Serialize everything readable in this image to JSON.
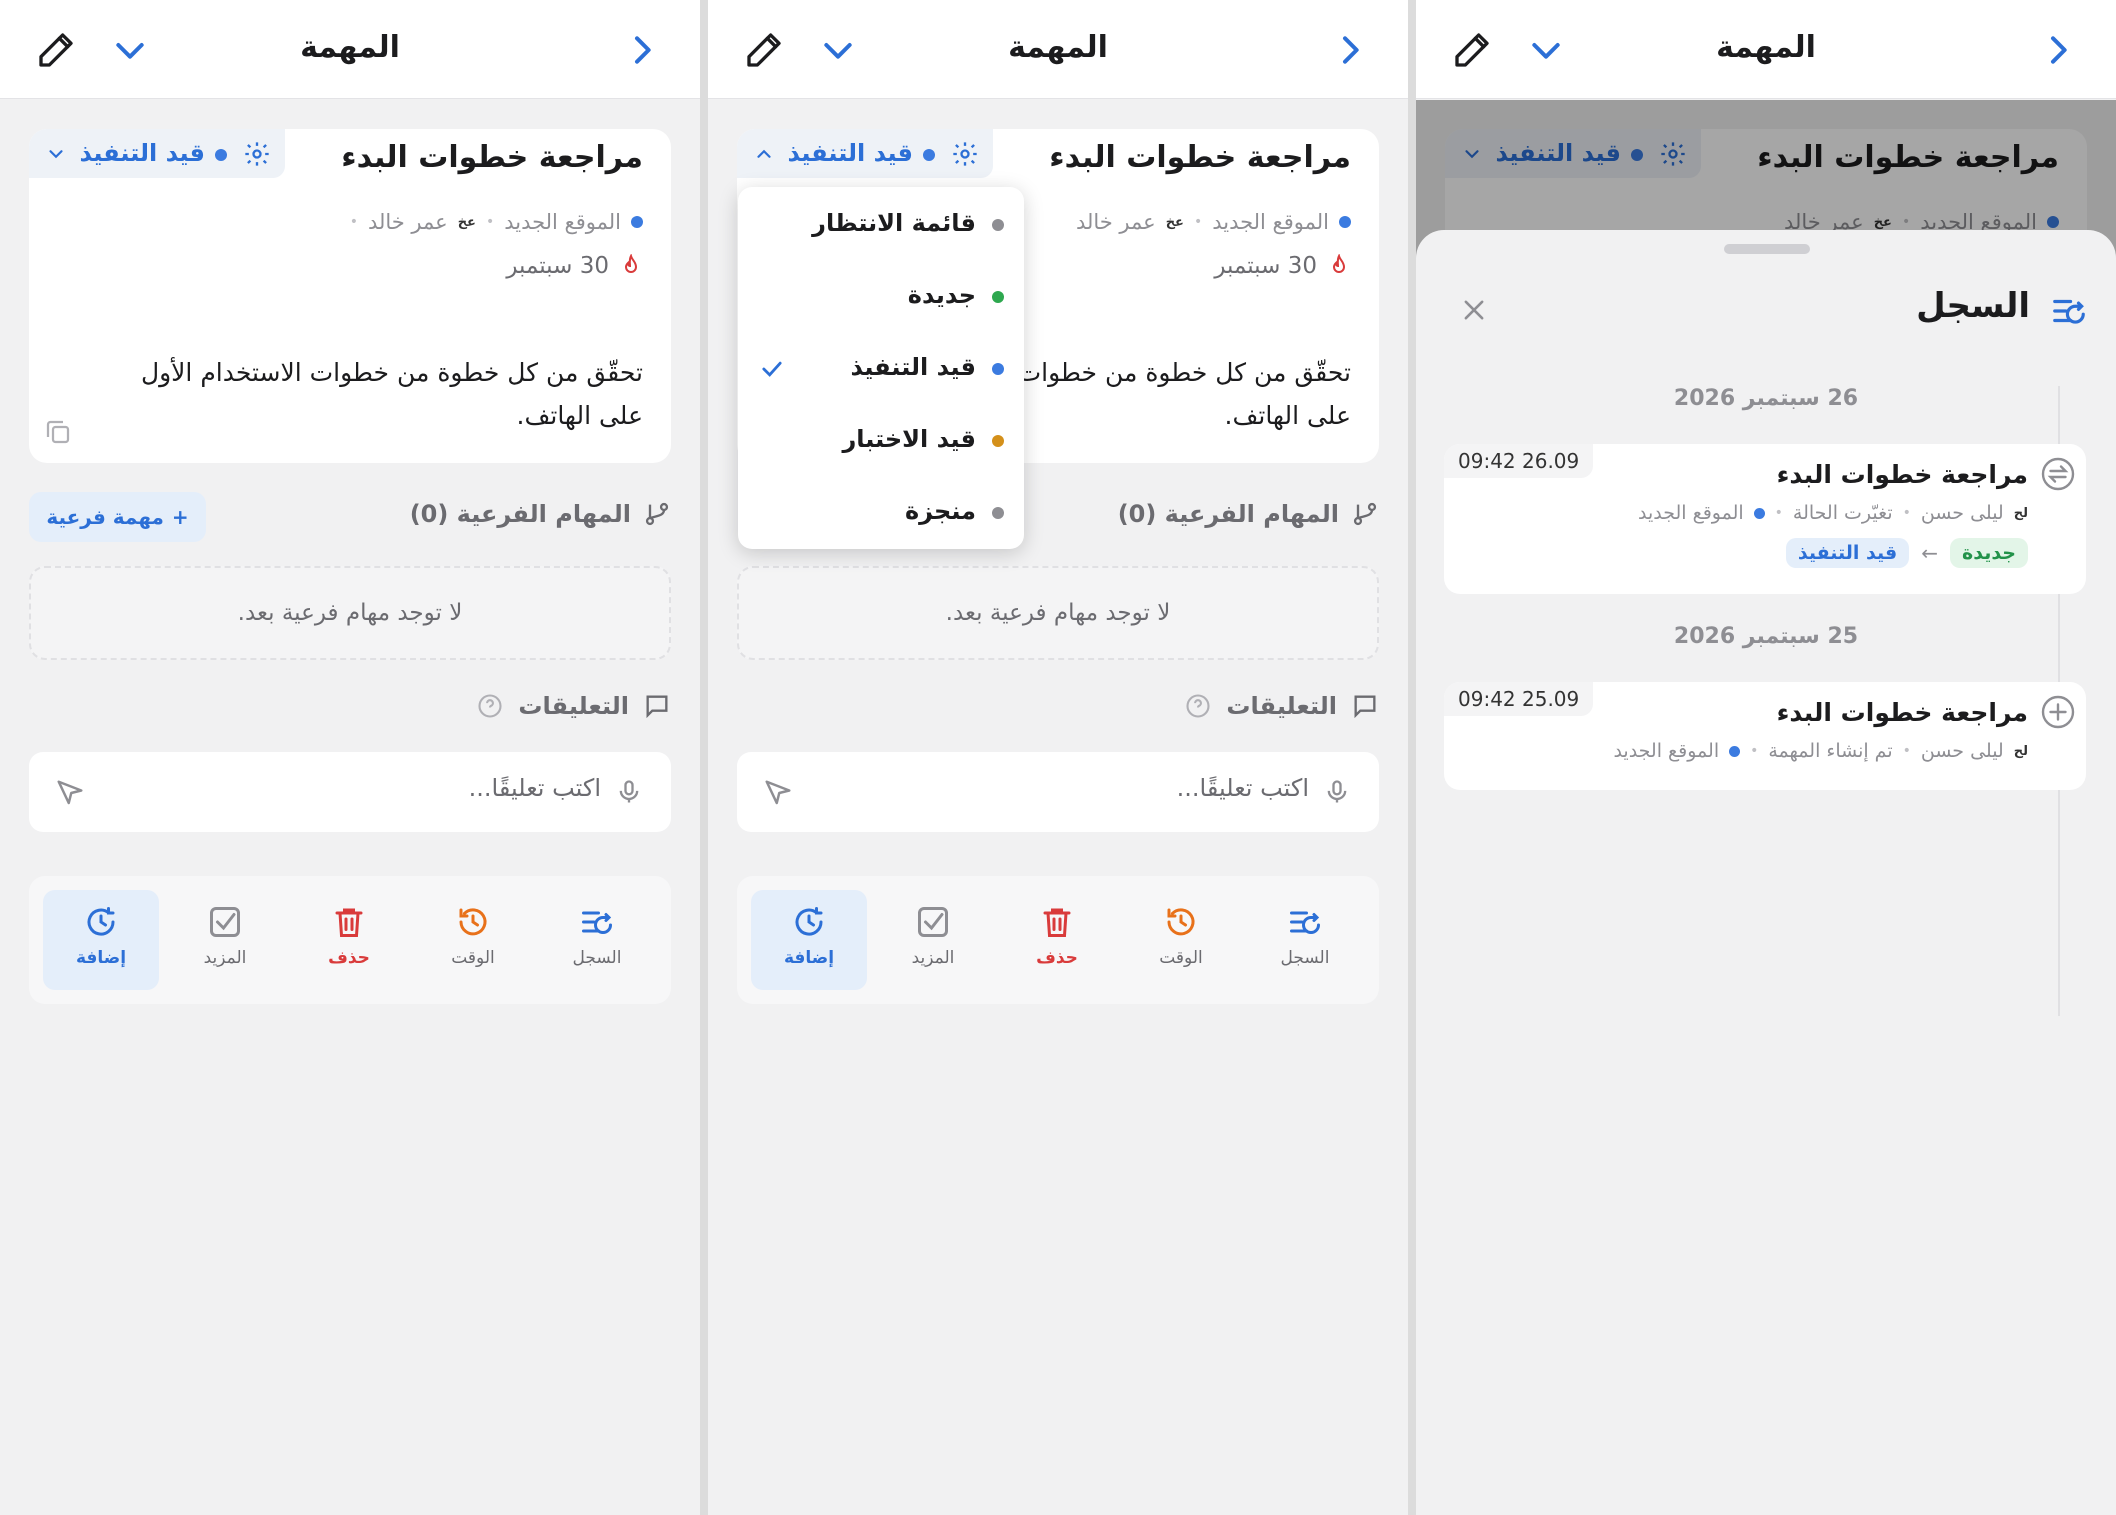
{
  "header": {
    "title": "المهمة"
  },
  "task": {
    "title": "مراجعة خطوات البدء",
    "status": "قيد التنفيذ",
    "project": "الموقع الجديد",
    "assignee_initials": "عخ",
    "assignee": "عمر خالد",
    "due": "30 سبتمبر",
    "description": "تحقّق من كل خطوة من خطوات الاستخدام الأول على الهاتف."
  },
  "subtasks": {
    "label": "المهام الفرعية (0)",
    "add_label": "مهمة فرعية",
    "empty": "لا توجد مهام فرعية بعد."
  },
  "comments": {
    "label": "التعليقات",
    "placeholder": "اكتب تعليقًا..."
  },
  "toolbar": {
    "add": "إضافة",
    "more": "المزيد",
    "delete": "حذف",
    "time": "الوقت",
    "log": "السجل"
  },
  "status_menu": {
    "items": [
      {
        "label": "قائمة الانتظار",
        "color": "#8e8e93"
      },
      {
        "label": "جديدة",
        "color": "#2ea84f"
      },
      {
        "label": "قيد التنفيذ",
        "color": "#3b7be0",
        "selected": true
      },
      {
        "label": "قيد الاختبار",
        "color": "#d4901a"
      },
      {
        "label": "منجزة",
        "color": "#8e8e93"
      }
    ]
  },
  "history": {
    "title": "السجل",
    "groups": [
      {
        "date": "26 سبتمبر 2026",
        "entry": {
          "time": "09:42 26.09",
          "title": "مراجعة خطوات البدء",
          "user_initials": "لح",
          "user": "ليلى حسن",
          "action": "تغيّرت الحالة",
          "project": "الموقع الجديد",
          "from": "جديدة",
          "to": "قيد التنفيذ"
        }
      },
      {
        "date": "25 سبتمبر 2026",
        "entry": {
          "time": "09:42 25.09",
          "title": "مراجعة خطوات البدء",
          "user_initials": "لح",
          "user": "ليلى حسن",
          "action": "تم إنشاء المهمة",
          "project": "الموقع الجديد"
        }
      }
    ]
  }
}
